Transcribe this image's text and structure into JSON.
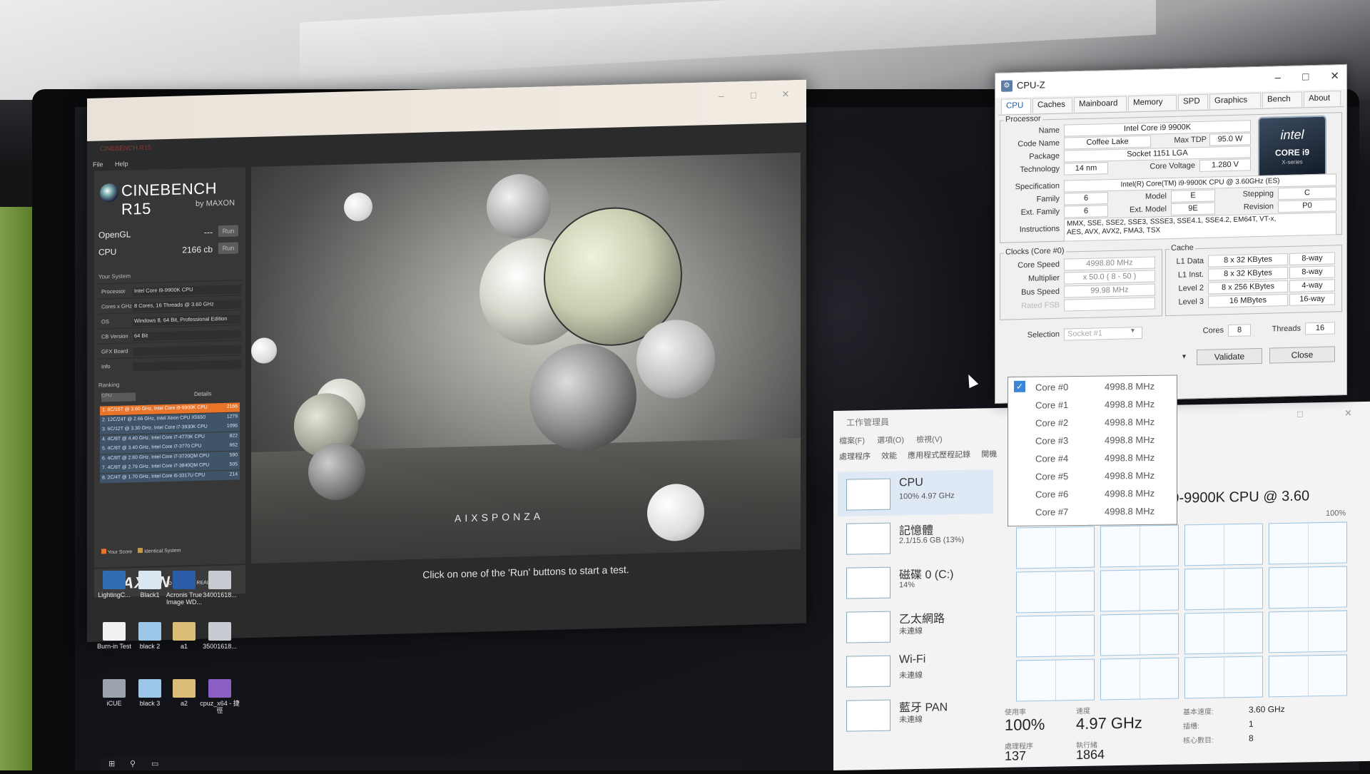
{
  "cinebench": {
    "window_title": "CINEBENCH R15",
    "menu": [
      "File",
      "Help"
    ],
    "logo_text": "CINEBENCH R15",
    "logo_sub": "by MAXON",
    "opengl_label": "OpenGL",
    "opengl_value": "---",
    "cpu_label": "CPU",
    "cpu_value": "2166 cb",
    "run_label": "Run",
    "system_heading": "Your System",
    "system": [
      {
        "key": "Processor",
        "value": "Intel Core i9-9900K CPU"
      },
      {
        "key": "Cores x GHz",
        "value": "8 Cores, 16 Threads @ 3.60 GHz"
      },
      {
        "key": "OS",
        "value": "Windows 8, 64 Bit, Professional Edition"
      },
      {
        "key": "CB Version",
        "value": "64 Bit"
      },
      {
        "key": "GFX Board",
        "value": ""
      },
      {
        "key": "Info",
        "value": ""
      }
    ],
    "ranking_heading": "Ranking",
    "ranking_dropdown": "CPU",
    "details_label": "Details",
    "ranking": [
      {
        "name": "1. 8C/16T @ 3.60 GHz, Intel Core i9-9900K CPU",
        "score": "2166",
        "highlight": true
      },
      {
        "name": "2. 12C/24T @ 2.66 GHz, Intel Xeon CPU X5650",
        "score": "1279"
      },
      {
        "name": "3. 6C/12T @ 3.30 GHz, Intel Core i7-3930K CPU",
        "score": "1096"
      },
      {
        "name": "4. 4C/8T @ 4.40 GHz, Intel Core i7-4770K CPU",
        "score": "822"
      },
      {
        "name": "5. 4C/8T @ 3.40 GHz, Intel Core i7-3770 CPU",
        "score": "662"
      },
      {
        "name": "6. 4C/8T @ 2.60 GHz, Intel Core i7-3720QM CPU",
        "score": "590"
      },
      {
        "name": "7. 4C/8T @ 2.79 GHz, Intel Core i7-3840QM CPU",
        "score": "505"
      },
      {
        "name": "8. 2C/4T @ 1.70 GHz, Intel Core i5-3317U CPU",
        "score": "214"
      }
    ],
    "legend_your_score": "Your Score",
    "legend_identical": "Identical System",
    "maxon_logo": "MAXON",
    "maxon_tagline": "3D FOR THE REAL WORLD",
    "render_watermark": "AIXSPONZA",
    "status": "Click on one of the 'Run' buttons to start a test."
  },
  "desktop": {
    "icons": [
      {
        "label": "LightingC..."
      },
      {
        "label": "Black1"
      },
      {
        "label": "Acronis True Image WD..."
      },
      {
        "label": "34001618..."
      },
      {
        "label": "Burn-in Test"
      },
      {
        "label": "black 2"
      },
      {
        "label": "a1"
      },
      {
        "label": "35001618..."
      },
      {
        "label": "iCUE"
      },
      {
        "label": "black 3"
      },
      {
        "label": "a2"
      },
      {
        "label": "cpuz_x64 - 捷徑"
      }
    ]
  },
  "cpuz": {
    "title": "CPU-Z",
    "tabs": [
      "CPU",
      "Caches",
      "Mainboard",
      "Memory",
      "SPD",
      "Graphics",
      "Bench",
      "About"
    ],
    "processor": {
      "group": "Processor",
      "name_label": "Name",
      "name": "Intel Core i9 9900K",
      "codename_label": "Code Name",
      "codename": "Coffee Lake",
      "maxtdp_label": "Max TDP",
      "maxtdp": "95.0 W",
      "package_label": "Package",
      "package": "Socket 1151 LGA",
      "technology_label": "Technology",
      "technology": "14 nm",
      "voltage_label": "Core Voltage",
      "voltage": "1.280 V",
      "spec_label": "Specification",
      "spec": "Intel(R) Core(TM) i9-9900K CPU @ 3.60GHz (ES)",
      "family_label": "Family",
      "family": "6",
      "model_label": "Model",
      "model": "E",
      "stepping_label": "Stepping",
      "stepping": "C",
      "extfamily_label": "Ext. Family",
      "extfamily": "6",
      "extmodel_label": "Ext. Model",
      "extmodel": "9E",
      "revision_label": "Revision",
      "revision": "P0",
      "instructions_label": "Instructions",
      "instructions_1": "MMX, SSE, SSE2, SSE3, SSSE3, SSE4.1, SSE4.2, EM64T, VT-x,",
      "instructions_2": "AES, AVX, AVX2, FMA3, TSX"
    },
    "intel_badge": {
      "brand": "intel",
      "line1": "CORE i9",
      "line2": "X-series"
    },
    "clocks": {
      "group": "Clocks (Core #0)",
      "speed_label": "Core Speed",
      "speed": "4998.80 MHz",
      "mult_label": "Multiplier",
      "mult": "x 50.0 ( 8 - 50 )",
      "bus_label": "Bus Speed",
      "bus": "99.98 MHz",
      "fsb_label": "Rated FSB",
      "fsb": ""
    },
    "cache": {
      "group": "Cache",
      "l1d_label": "L1 Data",
      "l1d": "8 x 32 KBytes",
      "l1d_way": "8-way",
      "l1i_label": "L1 Inst.",
      "l1i": "8 x 32 KBytes",
      "l1i_way": "8-way",
      "l2_label": "Level 2",
      "l2": "8 x 256 KBytes",
      "l2_way": "4-way",
      "l3_label": "Level 3",
      "l3": "16 MBytes",
      "l3_way": "16-way"
    },
    "selection_label": "Selection",
    "selection": "Socket #1",
    "cores_label": "Cores",
    "cores": "8",
    "threads_label": "Threads",
    "threads": "16",
    "validate_label": "Validate",
    "close_label": "Close",
    "core_popup": [
      {
        "core": "Core #0",
        "freq": "4998.8 MHz"
      },
      {
        "core": "Core #1",
        "freq": "4998.8 MHz"
      },
      {
        "core": "Core #2",
        "freq": "4998.8 MHz"
      },
      {
        "core": "Core #3",
        "freq": "4998.8 MHz"
      },
      {
        "core": "Core #4",
        "freq": "4998.8 MHz"
      },
      {
        "core": "Core #5",
        "freq": "4998.8 MHz"
      },
      {
        "core": "Core #6",
        "freq": "4998.8 MHz"
      },
      {
        "core": "Core #7",
        "freq": "4998.8 MHz"
      }
    ]
  },
  "taskmgr": {
    "title": "工作管理員",
    "menu": [
      "檔案(F)",
      "選項(O)",
      "檢視(V)"
    ],
    "tabs": [
      "處理程序",
      "效能",
      "應用程式歷程記錄",
      "開機"
    ],
    "side": [
      {
        "name": "CPU",
        "sub": "100% 4.97 GHz"
      },
      {
        "name": "記憶體",
        "sub": "2.1/15.6 GB (13%)"
      },
      {
        "name": "磁碟 0 (C:)",
        "sub": "14%"
      },
      {
        "name": "乙太網路",
        "sub": "未連線"
      },
      {
        "name": "Wi-Fi",
        "sub": "未連線"
      },
      {
        "name": "藍牙 PAN",
        "sub": "未連線"
      }
    ],
    "cpu_name": "M) i9-9900K CPU @ 3.60",
    "graph_max": "100%",
    "util_label": "使用率",
    "util": "100%",
    "speed_label": "速度",
    "speed": "4.97 GHz",
    "base_speed_label": "基本速度:",
    "base_speed": "3.60 GHz",
    "sockets_label": "插槽:",
    "sockets": "1",
    "cores_label": "核心數目:",
    "cores": "8",
    "processes_label": "處理程序",
    "processes": "137",
    "threads_label": "執行緒",
    "threads": "1864"
  }
}
